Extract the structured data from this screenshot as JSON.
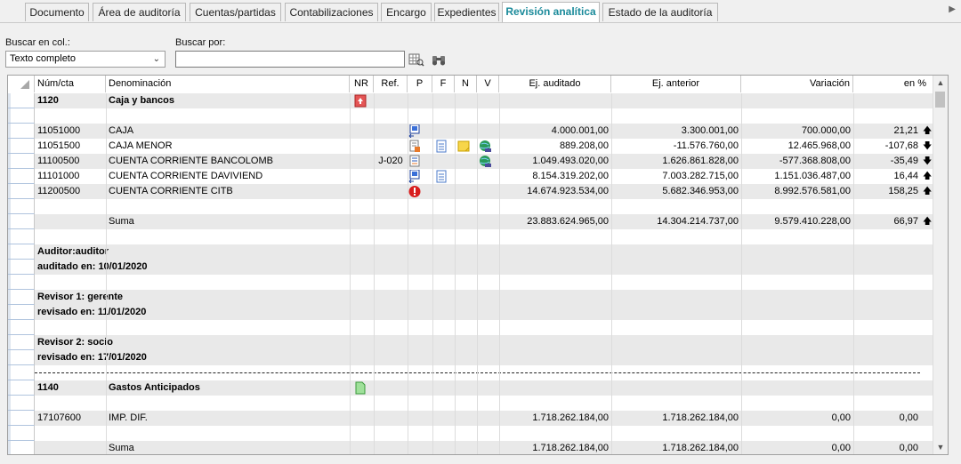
{
  "tabs": [
    "Documento",
    "Área de auditoría",
    "Cuentas/partidas",
    "Contabilizaciones",
    "Encargo",
    "Expedientes",
    "Revisión analítica",
    "Estado de la auditoría"
  ],
  "active_tab": "Revisión analítica",
  "search": {
    "col_label": "Buscar en col.:",
    "col_value": "Texto completo",
    "by_label": "Buscar por:",
    "by_value": ""
  },
  "columns": [
    "Núm/cta",
    "Denominación",
    "NR",
    "Ref.",
    "P",
    "F",
    "N",
    "V",
    "Ej. auditado",
    "Ej. anterior",
    "Variación",
    "en %"
  ],
  "groups": {
    "g1": {
      "code": "1120",
      "name": "Caja y bancos"
    },
    "g2": {
      "code": "1140",
      "name": "Gastos Anticipados"
    }
  },
  "accounts": [
    {
      "num": "11051000",
      "name": "CAJA",
      "ref": "",
      "audited": "4.000.001,00",
      "previous": "3.300.001,00",
      "variation": "700.000,00",
      "pct": "21,21",
      "trend": "up"
    },
    {
      "num": "11051500",
      "name": "CAJA MENOR",
      "ref": "",
      "audited": "889.208,00",
      "previous": "-11.576.760,00",
      "variation": "12.465.968,00",
      "pct": "-107,68",
      "trend": "down"
    },
    {
      "num": "11100500",
      "name": "CUENTA CORRIENTE BANCOLOMB",
      "ref": "J-020",
      "audited": "1.049.493.020,00",
      "previous": "1.626.861.828,00",
      "variation": "-577.368.808,00",
      "pct": "-35,49",
      "trend": "down"
    },
    {
      "num": "11101000",
      "name": "CUENTA CORRIENTE DAVIVIEND",
      "ref": "",
      "audited": "8.154.319.202,00",
      "previous": "7.003.282.715,00",
      "variation": "1.151.036.487,00",
      "pct": "16,44",
      "trend": "up"
    },
    {
      "num": "11200500",
      "name": "CUENTA CORRIENTE CITB",
      "ref": "",
      "audited": "14.674.923.534,00",
      "previous": "5.682.346.953,00",
      "variation": "8.992.576.581,00",
      "pct": "158,25",
      "trend": "up"
    }
  ],
  "sum1": {
    "label": "Suma",
    "audited": "23.883.624.965,00",
    "previous": "14.304.214.737,00",
    "variation": "9.579.410.228,00",
    "pct": "66,97",
    "trend": "up"
  },
  "review": {
    "auditor": "Auditor:auditor",
    "auditor_date": "auditado en: 10/01/2020",
    "rev1": "Revisor 1: gerente",
    "rev1_date": "revisado en: 11/01/2020",
    "rev2": "Revisor 2: socio",
    "rev2_date": "revisado en: 17/01/2020"
  },
  "account2": {
    "num": "17107600",
    "name": "IMP. DIF.",
    "audited": "1.718.262.184,00",
    "previous": "1.718.262.184,00",
    "variation": "0,00",
    "pct": "0,00"
  },
  "sum2": {
    "label": "Suma",
    "audited": "1.718.262.184,00",
    "previous": "1.718.262.184,00",
    "variation": "0,00",
    "pct": "0,00"
  }
}
